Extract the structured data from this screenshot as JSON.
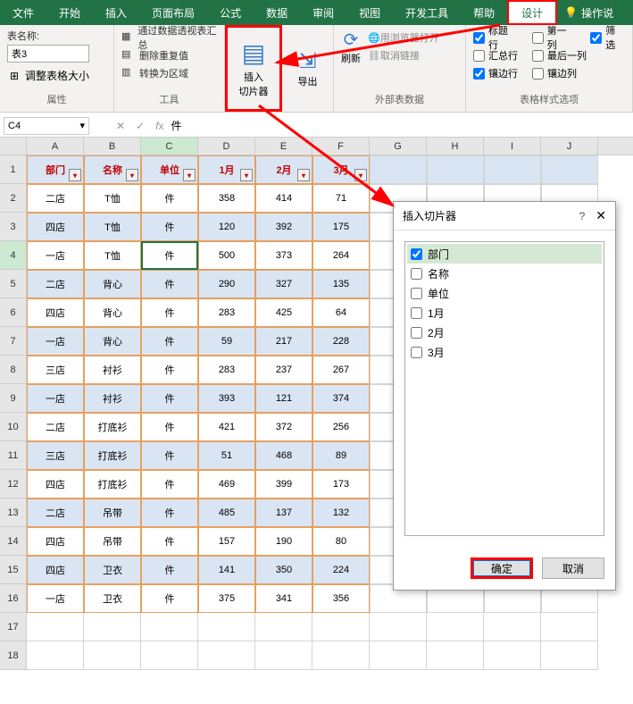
{
  "tabs": [
    "文件",
    "开始",
    "插入",
    "页面布局",
    "公式",
    "数据",
    "审阅",
    "视图",
    "开发工具",
    "帮助",
    "设计"
  ],
  "tip": "操作说",
  "ribbon": {
    "prop": {
      "label": "属性",
      "name_label": "表名称:",
      "name_value": "表3",
      "resize": "调整表格大小"
    },
    "tools": {
      "label": "工具",
      "pivot": "通过数据透视表汇总",
      "dedup": "删除重复值",
      "range": "转换为区域"
    },
    "slicer": {
      "label": "插入\n切片器"
    },
    "export": {
      "label": "导出"
    },
    "ext": {
      "label": "外部表数据",
      "refresh": "刷新",
      "browser": "用浏览器打开",
      "unlink": "取消链接"
    },
    "style": {
      "label": "表格样式选项",
      "title_row": "标题行",
      "first_col": "第一列",
      "filter": "筛选",
      "total_row": "汇总行",
      "last_col": "最后一列",
      "band_row": "镶边行",
      "band_col": "镶边列"
    }
  },
  "namebox": "C4",
  "formula_val": "件",
  "cols": [
    "A",
    "B",
    "C",
    "D",
    "E",
    "F",
    "G",
    "H",
    "I",
    "J"
  ],
  "headers": [
    "部门",
    "名称",
    "单位",
    "1月",
    "2月",
    "3月"
  ],
  "rows": [
    [
      "二店",
      "T恤",
      "件",
      "358",
      "414",
      "71"
    ],
    [
      "四店",
      "T恤",
      "件",
      "120",
      "392",
      "175"
    ],
    [
      "一店",
      "T恤",
      "件",
      "500",
      "373",
      "264"
    ],
    [
      "二店",
      "背心",
      "件",
      "290",
      "327",
      "135"
    ],
    [
      "四店",
      "背心",
      "件",
      "283",
      "425",
      "64"
    ],
    [
      "一店",
      "背心",
      "件",
      "59",
      "217",
      "228"
    ],
    [
      "三店",
      "衬衫",
      "件",
      "283",
      "237",
      "267"
    ],
    [
      "一店",
      "衬衫",
      "件",
      "393",
      "121",
      "374"
    ],
    [
      "二店",
      "打底衫",
      "件",
      "421",
      "372",
      "256"
    ],
    [
      "三店",
      "打底衫",
      "件",
      "51",
      "468",
      "89"
    ],
    [
      "四店",
      "打底衫",
      "件",
      "469",
      "399",
      "173"
    ],
    [
      "二店",
      "吊带",
      "件",
      "485",
      "137",
      "132"
    ],
    [
      "四店",
      "吊带",
      "件",
      "157",
      "190",
      "80"
    ],
    [
      "四店",
      "卫衣",
      "件",
      "141",
      "350",
      "224"
    ],
    [
      "一店",
      "卫衣",
      "件",
      "375",
      "341",
      "356"
    ]
  ],
  "dialog": {
    "title": "插入切片器",
    "help": "?",
    "items": [
      "部门",
      "名称",
      "单位",
      "1月",
      "2月",
      "3月"
    ],
    "ok": "确定",
    "cancel": "取消"
  }
}
